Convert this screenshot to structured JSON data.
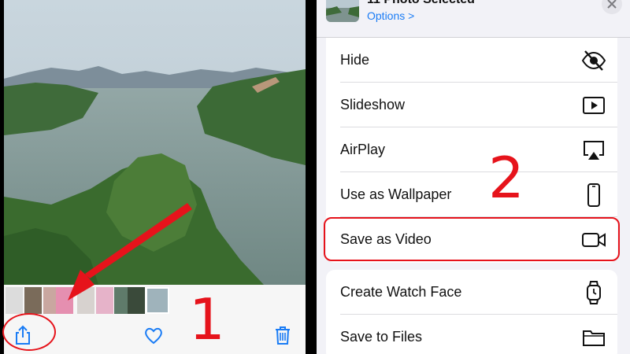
{
  "left": {
    "toolbar": {
      "share_icon": "share-icon",
      "favorite_icon": "heart-icon",
      "delete_icon": "trash-icon"
    }
  },
  "sheet": {
    "title": "11 Photo Selected",
    "options_label": "Options >",
    "close_icon": "close-icon",
    "group1": [
      {
        "label": "Hide",
        "icon": "eye-slash-icon"
      },
      {
        "label": "Slideshow",
        "icon": "play-icon"
      },
      {
        "label": "AirPlay",
        "icon": "airplay-icon"
      },
      {
        "label": "Use as Wallpaper",
        "icon": "phone-icon"
      },
      {
        "label": "Save as Video",
        "icon": "video-camera-icon"
      }
    ],
    "group2": [
      {
        "label": "Create Watch Face",
        "icon": "watch-icon"
      },
      {
        "label": "Save to Files",
        "icon": "folder-icon"
      }
    ]
  },
  "annotations": {
    "step1": "1",
    "step2": "2"
  },
  "colors": {
    "accent": "#1a7cf5",
    "annotation": "#e6131b"
  }
}
